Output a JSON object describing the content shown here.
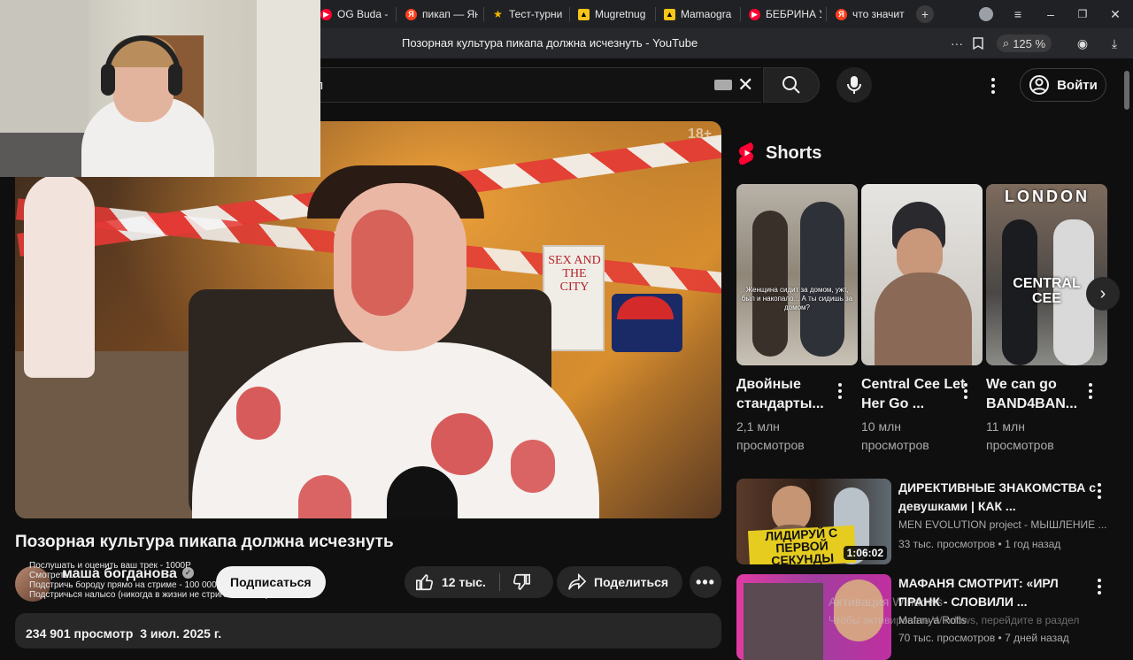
{
  "browser": {
    "tabs": [
      {
        "label": "OG Buda - б",
        "icon": "youtube-icon",
        "color": "#ff0033"
      },
      {
        "label": "пикап — Ян",
        "icon": "yandex-icon",
        "color": "#fc3f1d"
      },
      {
        "label": "Тест-турни",
        "icon": "star-icon",
        "color": "#f4b400"
      },
      {
        "label": "Mugretnug",
        "icon": "flag-icon",
        "color": "#f5c518"
      },
      {
        "label": "Mamaogra",
        "icon": "flag-icon",
        "color": "#f5c518"
      },
      {
        "label": "БЕБРИНА У",
        "icon": "youtube-icon",
        "color": "#ff0033"
      },
      {
        "label": "что значит",
        "icon": "yandex-icon",
        "color": "#fc3f1d"
      }
    ],
    "page_title": "Позорная культура пикапа должна исчезнуть - YouTube",
    "zoom": "125 %"
  },
  "header": {
    "search_value": "п",
    "signin_label": "Войти"
  },
  "player": {
    "age_badge": "18+",
    "book_text": "SEX AND THE CITY"
  },
  "video": {
    "title": "Позорная культура пикапа должна исчезнуть",
    "channel": "маша богданова",
    "subscribe_label": "Подписаться",
    "likes": "12 тыс.",
    "share_label": "Поделиться",
    "views_date": "234 901 просмотр  3 июл. 2025 г.",
    "overlay_lines": [
      "Послушать и оценить ваш трек - 1000Р",
      "Смотреть...",
      "Подстричь бороду прямо на стриме - 100 000р",
      "Подстричься налысо (никогда в жизни не стригся налысо)"
    ]
  },
  "shorts": {
    "heading": "Shorts",
    "items": [
      {
        "title": "Двойные стандарты...",
        "views": "2,1 млн просмотров",
        "caption": "Женщина сидит за домом, ужт, был и накопало... А ты сидишь за домом?"
      },
      {
        "title": "Central Cee Let Her Go ...",
        "views": "10 млн просмотров",
        "caption": ""
      },
      {
        "title": "We can go BAND4BAN...",
        "views": "11 млн просмотров",
        "caption": "LONDON CENTRAL CEE"
      }
    ]
  },
  "recommendations": [
    {
      "title": "ДИРЕКТИВНЫЕ ЗНАКОМСТВА с девушками | КАК ...",
      "channel": "MEN EVOLUTION project - МЫШЛЕНИЕ ...",
      "meta": "33 тыс. просмотров • 1 год назад",
      "duration": "1:06:02",
      "thumb_text": "ЛИДИРУЙ С ПЕРВОЙ СЕКУНДЫ"
    },
    {
      "title": "МАФАНЯ СМОТРИТ: «ИРЛ ПРАНК - СЛОВИЛИ ...",
      "channel": "Mafanya Rofls",
      "meta": "70 тыс. просмотров • 7 дней назад",
      "duration": "",
      "thumb_text": ""
    }
  ],
  "watermark": {
    "line1": "Активация Windows",
    "line2": "Чтобы активировать Windows, перейдите в раздел"
  }
}
